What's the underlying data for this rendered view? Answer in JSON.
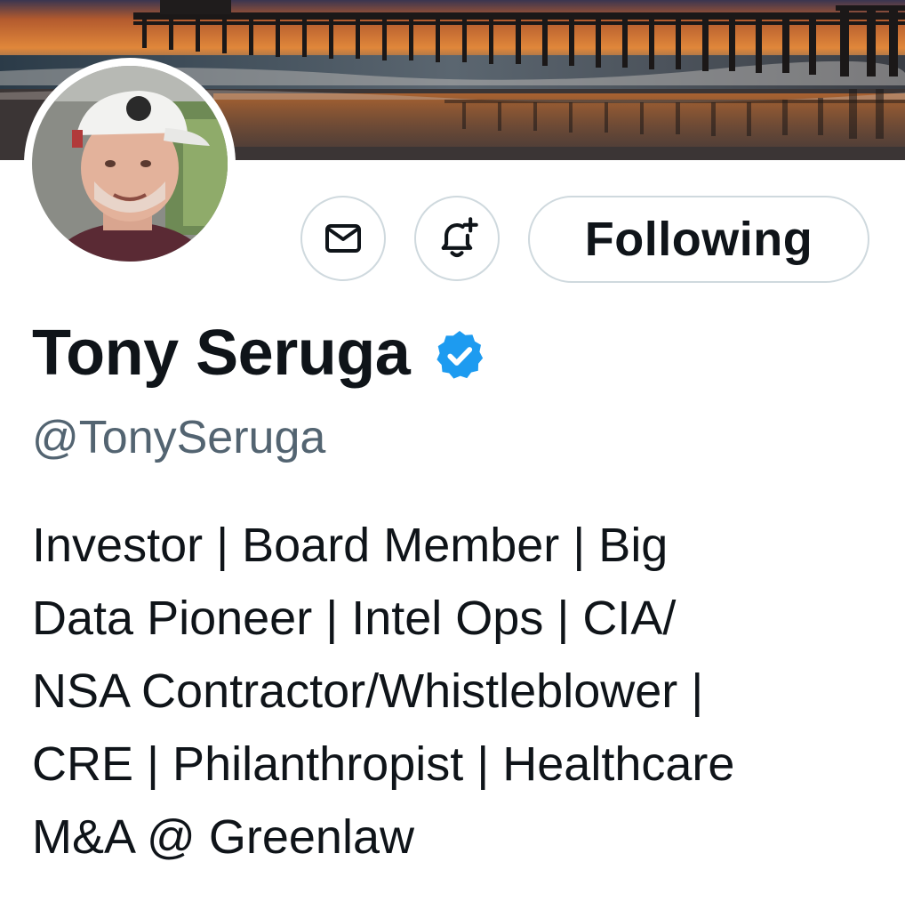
{
  "profile": {
    "display_name": "Tony Seruga",
    "handle": "@TonySeruga",
    "verified": true,
    "bio_lines": [
      "Investor | Board Member | Big",
      "Data Pioneer | Intel Ops | CIA/",
      "NSA Contractor/Whistleblower |",
      "CRE | Philanthropist | Healthcare",
      "M&A @ Greenlaw"
    ]
  },
  "actions": {
    "message_icon": "envelope-icon",
    "notify_icon": "bell-plus-icon",
    "follow_label": "Following"
  },
  "colors": {
    "verified_blue": "#1d9bf0",
    "handle_gray": "#536471",
    "text": "#0f1419",
    "border": "#cfd9de"
  }
}
